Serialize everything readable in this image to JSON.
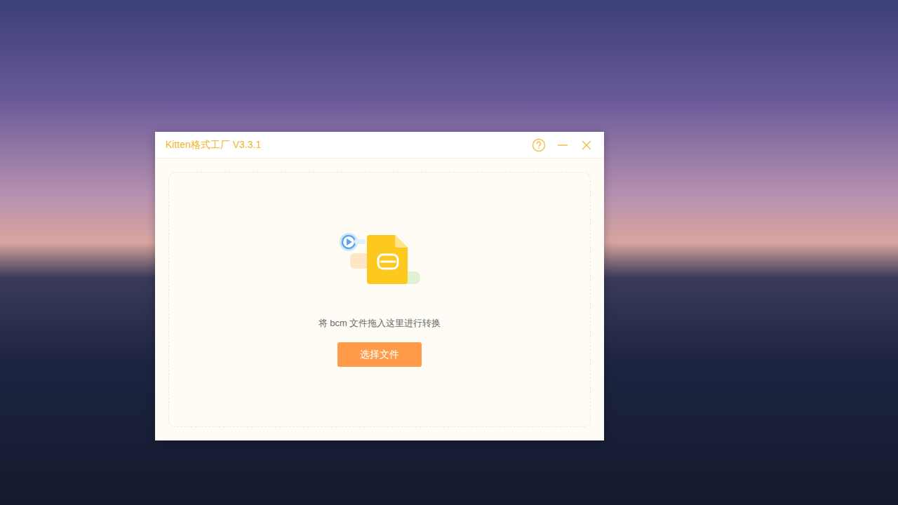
{
  "window": {
    "title": "Kitten格式工厂 V3.3.1"
  },
  "dropzone": {
    "hint": "将 bcm 文件拖入这里进行转换",
    "button": "选择文件"
  }
}
